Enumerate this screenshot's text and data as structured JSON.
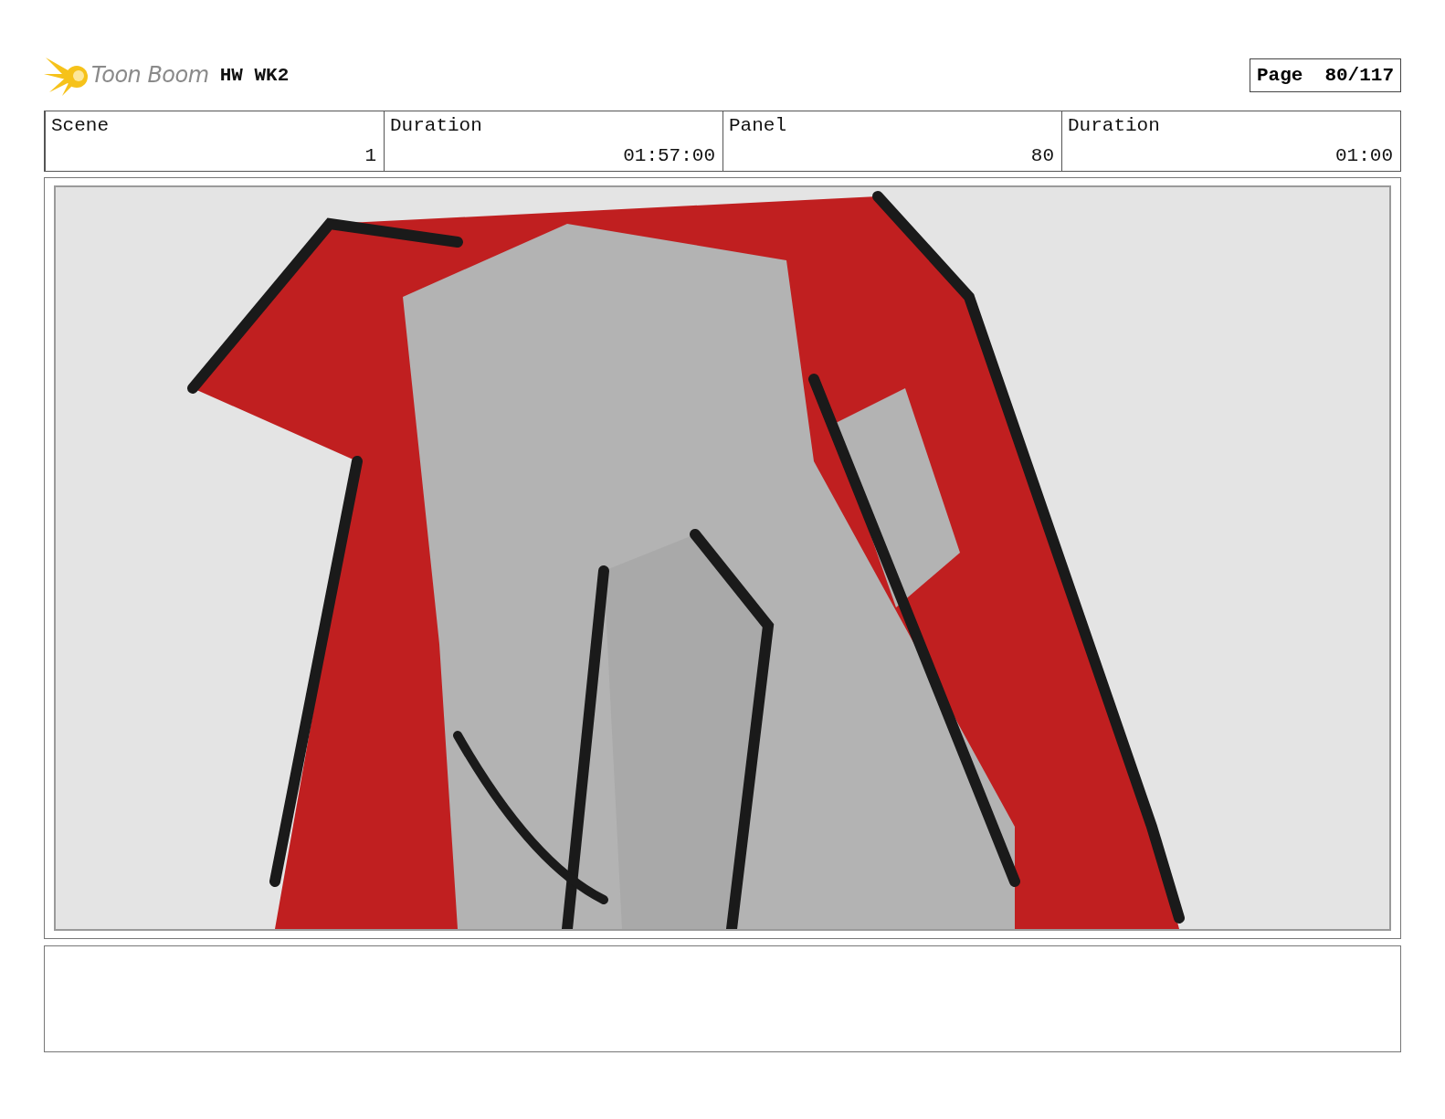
{
  "header": {
    "logo_text": "Toon Boom",
    "project": "HW WK2",
    "page_label": "Page",
    "page_number": "80/117"
  },
  "info_table": {
    "columns": [
      "Scene",
      "Duration",
      "Panel",
      "Duration"
    ],
    "rows": [
      [
        "1",
        "01:57:00",
        "80",
        "01:00"
      ]
    ]
  }
}
